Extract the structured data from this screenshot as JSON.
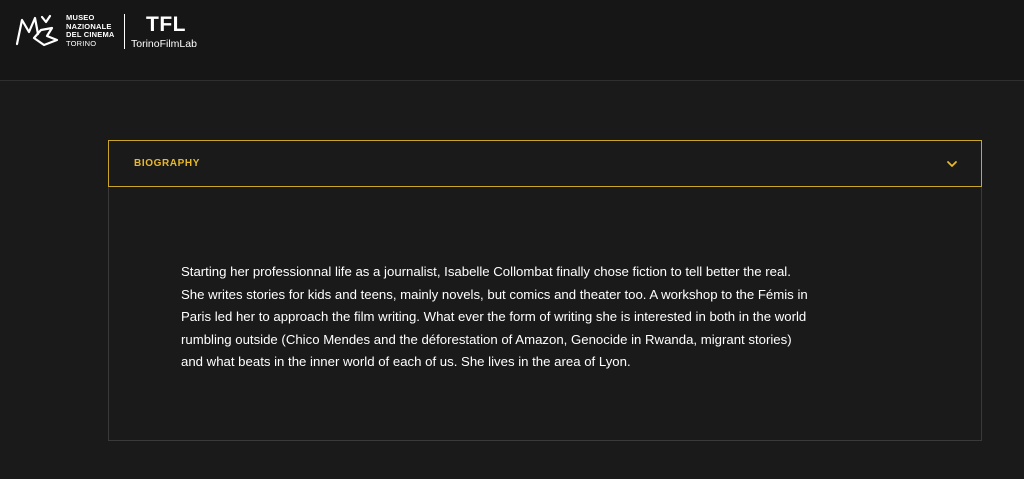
{
  "header": {
    "museum_logo": {
      "line1": "MUSEO",
      "line2": "NAZIONALE",
      "line3": "DEL CINEMA",
      "line4": "TORINO"
    },
    "tfl_logo": {
      "mark": "TFL",
      "name": "TorinoFilmLab"
    }
  },
  "accordion": {
    "title": "BIOGRAPHY",
    "expanded": true,
    "body_lines": [
      "Starting her professionnal life as a journalist, Isabelle Collombat finally chose fiction to tell better the real.",
      "She writes stories for kids and teens, mainly novels, but comics and theater too. A workshop to the Fémis in",
      "Paris led her to approach the film writing. What ever the form of writing she is interested in both in the world",
      "rumbling outside (Chico Mendes and the déforestation of Amazon, Genocide in Rwanda, migrant stories)",
      "and what beats in the inner world of each of us. She lives in the area of Lyon."
    ]
  },
  "colors": {
    "background": "#1a1a1a",
    "accent": "#e8b92b",
    "border_accent": "#c9a52a",
    "text": "#ffffff"
  },
  "icons": {
    "museum": "museo-cinema-logo-icon",
    "chevron": "chevron-down-icon"
  }
}
